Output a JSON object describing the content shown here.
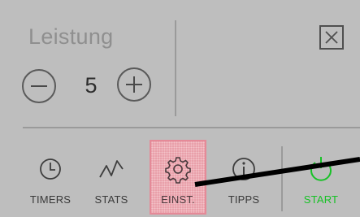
{
  "power": {
    "label": "Leistung",
    "value": "5"
  },
  "nav": {
    "timers": "TIMERS",
    "stats": "STATS",
    "settings": "EINST.",
    "tips": "TIPPS",
    "start": "START"
  },
  "icons": {
    "minus": "minus-circle",
    "plus": "plus-circle",
    "close": "close-box",
    "timers": "clock",
    "stats": "zigzag-line",
    "settings": "gear",
    "tips": "info-circle",
    "start": "power"
  },
  "colors": {
    "background": "#bebebe",
    "highlight": "#e9a0aa",
    "start_accent": "#18c227"
  }
}
